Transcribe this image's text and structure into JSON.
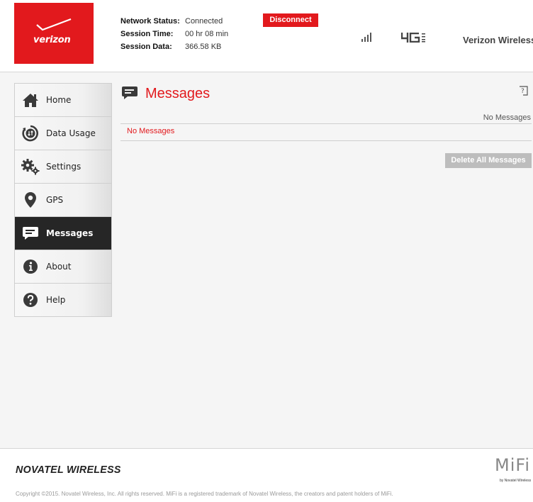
{
  "header": {
    "logo_text": "verizon",
    "status": [
      {
        "key": "Network Status:",
        "value": "Connected"
      },
      {
        "key": "Session Time:",
        "value": "00 hr 08 min"
      },
      {
        "key": "Session Data:",
        "value": "366.58 KB"
      }
    ],
    "disconnect_label": "Disconnect",
    "network_type": "4G LTE",
    "carrier": "Verizon Wireless"
  },
  "sidebar": {
    "items": [
      {
        "label": "Home",
        "icon": "home-icon"
      },
      {
        "label": "Data Usage",
        "icon": "data-usage-icon"
      },
      {
        "label": "Settings",
        "icon": "gear-icon"
      },
      {
        "label": "GPS",
        "icon": "location-pin-icon"
      },
      {
        "label": "Messages",
        "icon": "message-icon",
        "active": true
      },
      {
        "label": "About",
        "icon": "info-icon"
      },
      {
        "label": "Help",
        "icon": "question-icon"
      }
    ]
  },
  "content": {
    "title": "Messages",
    "help_glyph": "?",
    "right_note": "No Messages",
    "empty_text": "No Messages",
    "delete_all_label": "Delete All Messages"
  },
  "footer": {
    "brand": "NOVATEL WIRELESS",
    "product": "MiFi",
    "product_sub": "by Novatel Wireless",
    "copyright": "Copyright ©2015. Novatel Wireless, Inc. All rights reserved. MiFi is a registered trademark of Novatel Wireless, the creators and patent holders of MiFi."
  },
  "colors": {
    "accent": "#e2191d",
    "active_nav": "#262626",
    "disabled_button": "#bdbdbd"
  }
}
